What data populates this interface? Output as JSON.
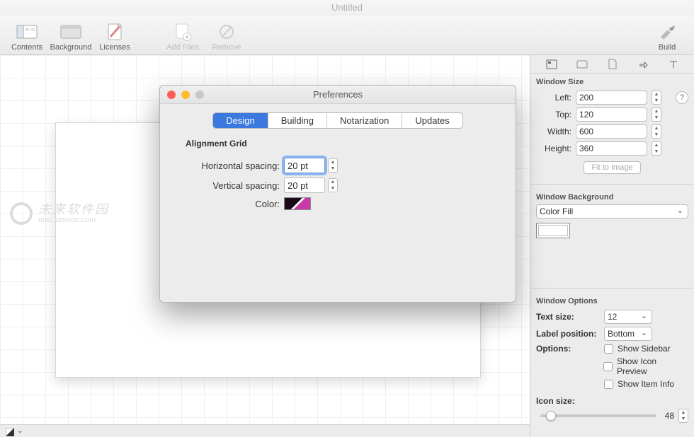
{
  "window_title": "Untitled",
  "toolbar": {
    "contents": "Contents",
    "background": "Background",
    "licenses": "Licenses",
    "add_files": "Add Files",
    "remove": "Remove",
    "build": "Build"
  },
  "prefs": {
    "title": "Preferences",
    "tabs": {
      "design": "Design",
      "building": "Building",
      "notarization": "Notarization",
      "updates": "Updates"
    },
    "alignment_heading": "Alignment Grid",
    "hspacing_label": "Horizontal spacing:",
    "vspacing_label": "Vertical spacing:",
    "color_label": "Color:",
    "hspacing_value": "20 pt",
    "vspacing_value": "20 pt"
  },
  "inspector": {
    "window_size_heading": "Window Size",
    "left_label": "Left:",
    "left_value": "200",
    "top_label": "Top:",
    "top_value": "120",
    "width_label": "Width:",
    "width_value": "600",
    "height_label": "Height:",
    "height_value": "360",
    "fit_btn": "Fit to Image",
    "bg_heading": "Window Background",
    "bg_mode": "Color Fill",
    "options_heading": "Window Options",
    "text_size_label": "Text size:",
    "text_size_value": "12",
    "label_pos_label": "Label position:",
    "label_pos_value": "Bottom",
    "options_label": "Options:",
    "opt_sidebar": "Show Sidebar",
    "opt_preview": "Show Icon Preview",
    "opt_iteminfo": "Show Item Info",
    "icon_size_label": "Icon size:",
    "icon_size_value": "48"
  },
  "watermark": {
    "line1": "未来软件园",
    "line2": "mac.orsoon.com"
  }
}
